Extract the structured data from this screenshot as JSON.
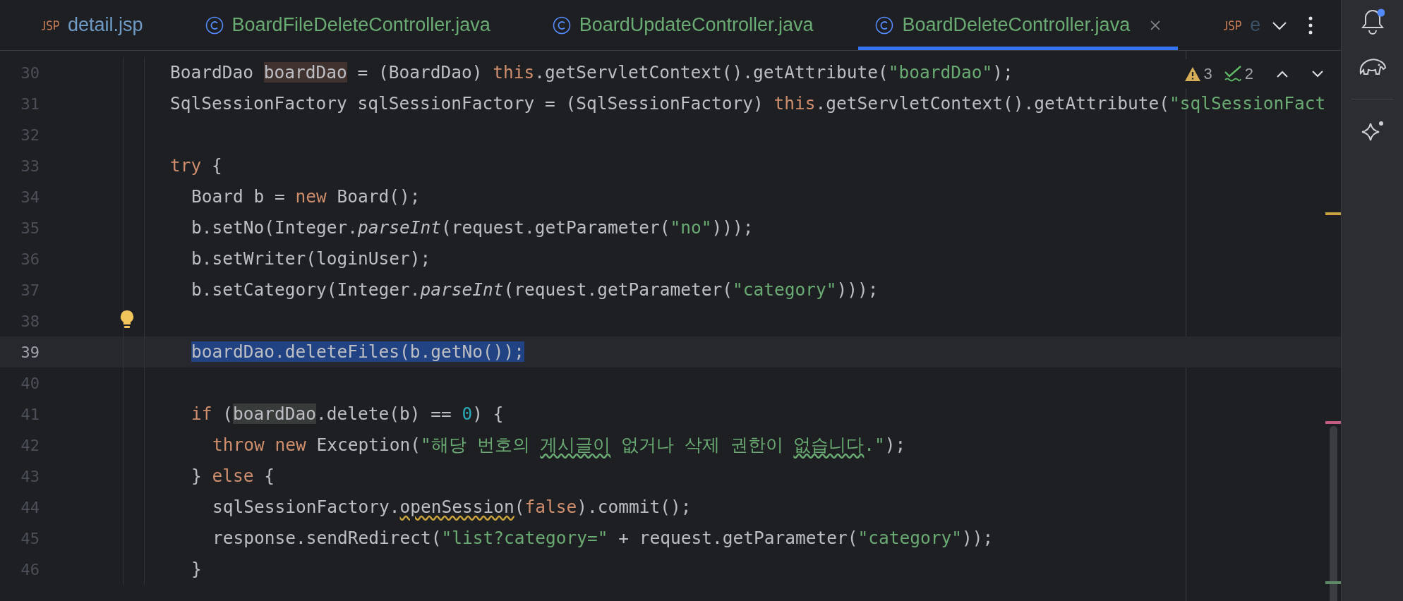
{
  "tabs": [
    {
      "label": "detail.jsp",
      "kind": "jsp",
      "selected": false,
      "color": "#6f9bc6"
    },
    {
      "label": "BoardFileDeleteController.java",
      "kind": "class",
      "selected": false,
      "color": "#6aab73"
    },
    {
      "label": "BoardUpdateController.java",
      "kind": "class",
      "selected": false,
      "color": "#6aab73"
    },
    {
      "label": "BoardDeleteController.java",
      "kind": "class",
      "selected": true,
      "color": "#6aab73"
    },
    {
      "label": "e",
      "kind": "jsp",
      "selected": false,
      "color": "#3d5266"
    }
  ],
  "inspections": {
    "warnings": "3",
    "weak_warnings": "2"
  },
  "lines": [
    {
      "number": "30",
      "current": false,
      "tokens": [
        {
          "text": "BoardDao ",
          "kind": "plain"
        },
        {
          "text": "boardDao",
          "kind": "write-ref"
        },
        {
          "text": " = (BoardDao) ",
          "kind": "plain"
        },
        {
          "text": "this",
          "kind": "keyword"
        },
        {
          "text": ".getServletContext().getAttribute(",
          "kind": "plain"
        },
        {
          "text": "\"boardDao\"",
          "kind": "string"
        },
        {
          "text": ");",
          "kind": "plain"
        }
      ]
    },
    {
      "number": "31",
      "current": false,
      "tokens": [
        {
          "text": "SqlSessionFactory sqlSessionFactory = (SqlSessionFactory) ",
          "kind": "plain"
        },
        {
          "text": "this",
          "kind": "keyword"
        },
        {
          "text": ".getServletContext().getAttribute(",
          "kind": "plain"
        },
        {
          "text": "\"sqlSessionFact",
          "kind": "string"
        }
      ]
    },
    {
      "number": "32",
      "current": false
    },
    {
      "number": "33",
      "current": false,
      "tokens": [
        {
          "text": "try",
          "kind": "keyword"
        },
        {
          "text": " {",
          "kind": "plain"
        }
      ],
      "children": [
        {
          "number": "34",
          "current": false,
          "tokens": [
            {
              "text": "Board b = ",
              "kind": "plain"
            },
            {
              "text": "new",
              "kind": "keyword"
            },
            {
              "text": " Board();",
              "kind": "plain"
            }
          ]
        },
        {
          "number": "35",
          "current": false,
          "tokens": [
            {
              "text": "b.setNo(Integer.",
              "kind": "plain"
            },
            {
              "text": "parseInt",
              "kind": "static"
            },
            {
              "text": "(request.getParameter(",
              "kind": "plain"
            },
            {
              "text": "\"no\"",
              "kind": "string"
            },
            {
              "text": ")));",
              "kind": "plain"
            }
          ]
        },
        {
          "number": "36",
          "current": false,
          "tokens": [
            {
              "text": "b.setWriter(loginUser);",
              "kind": "plain"
            }
          ]
        },
        {
          "number": "37",
          "current": false,
          "tokens": [
            {
              "text": "b.setCategory(Integer.",
              "kind": "plain"
            },
            {
              "text": "parseInt",
              "kind": "static"
            },
            {
              "text": "(request.getParameter(",
              "kind": "plain"
            },
            {
              "text": "\"category\"",
              "kind": "string"
            },
            {
              "text": ")));",
              "kind": "plain"
            }
          ]
        },
        {
          "number": "38",
          "current": false,
          "bulb": true
        },
        {
          "number": "39",
          "current": true,
          "tokens": [
            {
              "text": "boardDao.deleteFiles(b.getNo());",
              "kind": "selection"
            }
          ]
        },
        {
          "number": "40",
          "current": false
        },
        {
          "number": "41",
          "current": false,
          "tokens": [
            {
              "text": "if",
              "kind": "keyword"
            },
            {
              "text": " (",
              "kind": "plain"
            },
            {
              "text": "boardDao",
              "kind": "read-ref"
            },
            {
              "text": ".delete(b) == ",
              "kind": "plain"
            },
            {
              "text": "0",
              "kind": "number"
            },
            {
              "text": ") {",
              "kind": "plain"
            }
          ],
          "children": [
            {
              "number": "42",
              "current": false,
              "tokens": [
                {
                  "text": "throw new",
                  "kind": "keyword"
                },
                {
                  "text": " Exception(",
                  "kind": "plain"
                },
                {
                  "text": "\"해당 번호의 ",
                  "kind": "string"
                },
                {
                  "text": "게시글이",
                  "kind": "typo"
                },
                {
                  "text": " 없거나 삭제 권한이 ",
                  "kind": "string"
                },
                {
                  "text": "없습니다",
                  "kind": "typo"
                },
                {
                  "text": ".\"",
                  "kind": "string"
                },
                {
                  "text": ");",
                  "kind": "plain"
                }
              ]
            }
          ]
        },
        {
          "number": "43",
          "current": false,
          "tokens": [
            {
              "text": "} ",
              "kind": "plain"
            },
            {
              "text": "else",
              "kind": "keyword"
            },
            {
              "text": " {",
              "kind": "plain"
            }
          ],
          "children": [
            {
              "number": "44",
              "current": false,
              "tokens": [
                {
                  "text": "sqlSessionFactory.",
                  "kind": "plain"
                },
                {
                  "text": "openSession",
                  "kind": "warning"
                },
                {
                  "text": "(",
                  "kind": "plain"
                },
                {
                  "text": "false",
                  "kind": "keyword"
                },
                {
                  "text": ").commit();",
                  "kind": "plain"
                }
              ]
            },
            {
              "number": "45",
              "current": false,
              "tokens": [
                {
                  "text": "response.sendRedirect(",
                  "kind": "plain"
                },
                {
                  "text": "\"list?category=\"",
                  "kind": "string"
                },
                {
                  "text": " + request.getParameter(",
                  "kind": "plain"
                },
                {
                  "text": "\"category\"",
                  "kind": "string"
                },
                {
                  "text": "));",
                  "kind": "plain"
                }
              ]
            }
          ]
        },
        {
          "number": "46",
          "current": false,
          "tokens": [
            {
              "text": "}",
              "kind": "plain"
            }
          ]
        }
      ]
    }
  ]
}
